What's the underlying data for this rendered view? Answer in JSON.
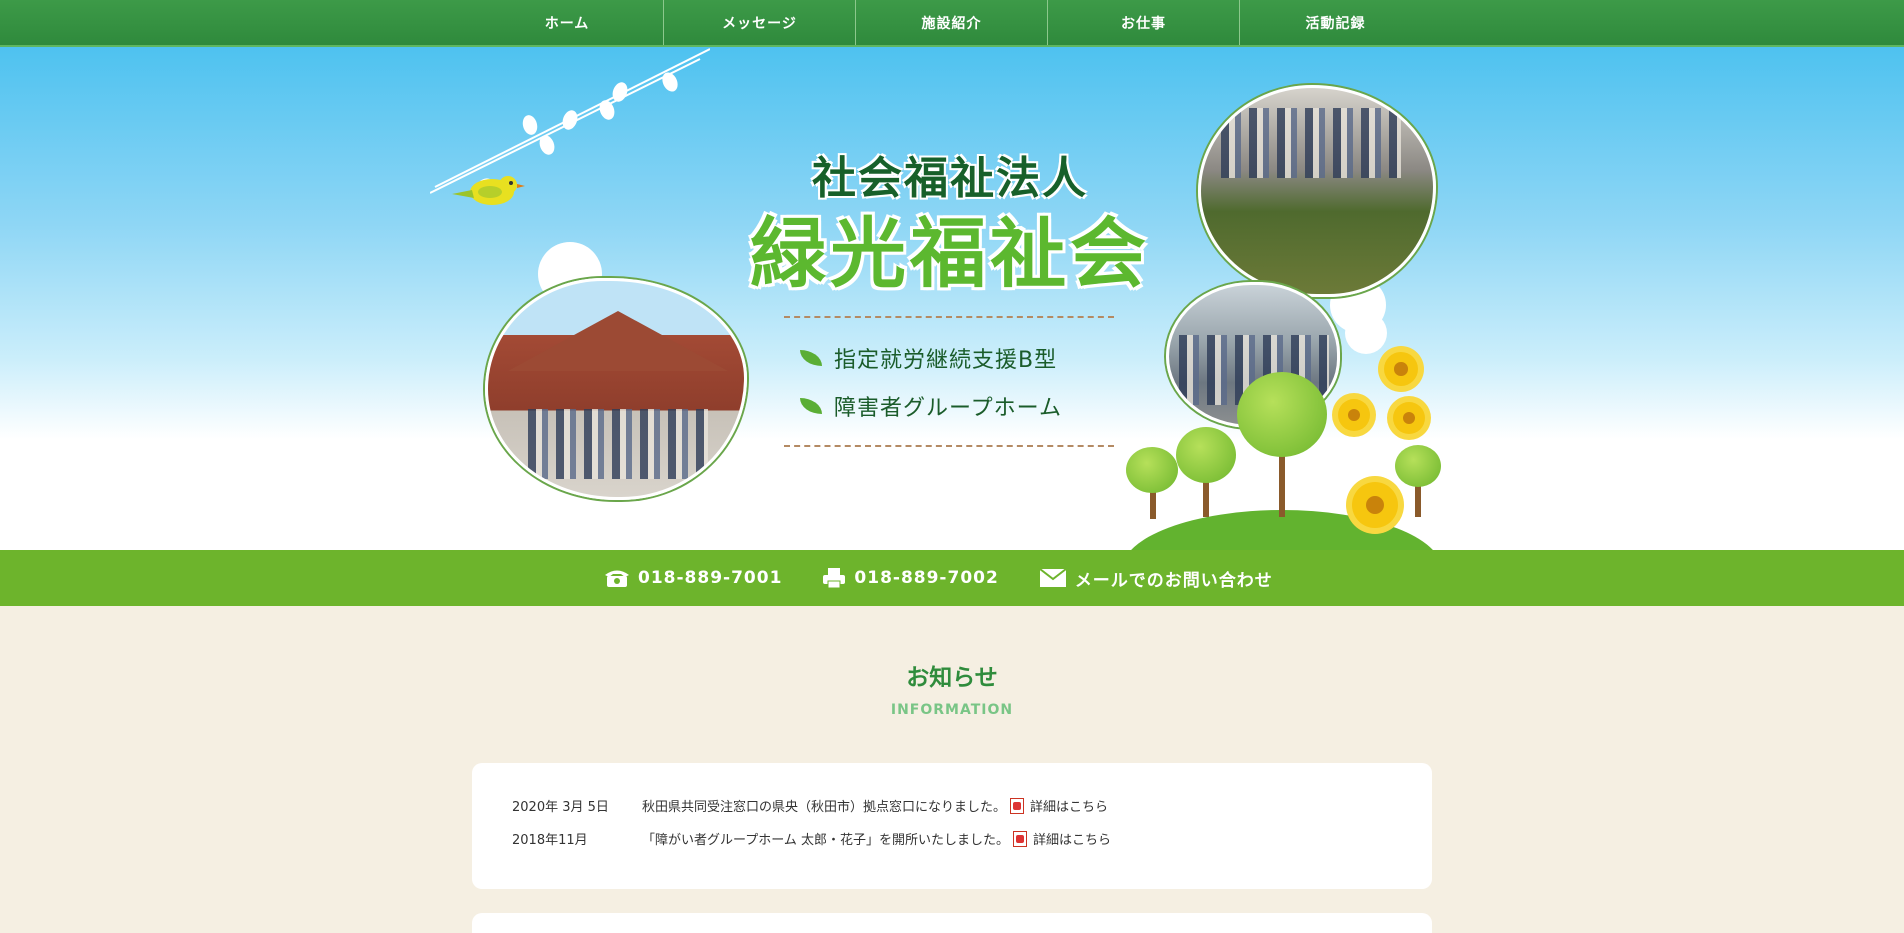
{
  "nav": {
    "items": [
      {
        "label": "ホーム"
      },
      {
        "label": "メッセージ"
      },
      {
        "label": "施設紹介"
      },
      {
        "label": "お仕事"
      },
      {
        "label": "活動記録"
      }
    ]
  },
  "hero": {
    "title_small": "社会福祉法人",
    "title_large": "緑光福祉会",
    "services": [
      {
        "label": "指定就労継続支援B型"
      },
      {
        "label": "障害者グループホーム"
      }
    ]
  },
  "contact": {
    "phone": "018-889-7001",
    "fax": "018-889-7002",
    "mail": "メールでのお問い合わせ",
    "phone_icon": "phone-icon",
    "fax_icon": "fax-icon",
    "mail_icon": "mail-icon"
  },
  "info": {
    "title": "お知らせ",
    "subtitle": "INFORMATION",
    "news": [
      {
        "date": "2020年 3月 5日",
        "text": "秋田県共同受注窓口の県央（秋田市）拠点窓口になりました。",
        "link": "詳細はこちら"
      },
      {
        "date": "2018年11月",
        "text": "「障がい者グループホーム 太郎・花子」を開所いたしました。",
        "link": "詳細はこちら"
      }
    ]
  },
  "colors": {
    "nav_green": "#3d9a48",
    "contact_green": "#6db42c",
    "title_dark_green": "#17602a",
    "title_light_green": "#5cb82f",
    "background": "#f5efe2"
  }
}
